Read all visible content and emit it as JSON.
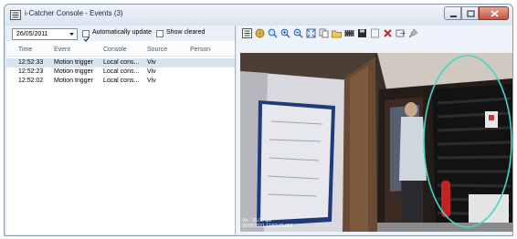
{
  "window": {
    "title": "i-Catcher Console - Events (3)"
  },
  "events_panel": {
    "date_value": "26/05/2011",
    "auto_update_label": "Automatically update",
    "auto_update_checked": true,
    "show_cleared_label": "Show cleared",
    "show_cleared_checked": false,
    "columns": [
      "Time",
      "Event",
      "Console",
      "Source",
      "Person"
    ],
    "rows": [
      {
        "time": "12:52:33",
        "event": "Motion trigger",
        "console": "Local cons...",
        "source": "Viv",
        "person": "",
        "selected": true
      },
      {
        "time": "12:52:23",
        "event": "Motion trigger",
        "console": "Local cons...",
        "source": "Viv",
        "person": "",
        "selected": false
      },
      {
        "time": "12:52:02",
        "event": "Motion trigger",
        "console": "Local cons...",
        "source": "Viv",
        "person": "",
        "selected": false
      }
    ]
  },
  "viewer": {
    "toolbar_icons": [
      "list-icon",
      "globe-icon",
      "zoom-icon",
      "zoom-in-icon",
      "zoom-out-icon",
      "fit-icon",
      "copy-icon",
      "folder-icon",
      "film-icon",
      "save-icon",
      "blank-icon",
      "delete-icon",
      "export-icon",
      "pin-icon"
    ],
    "caption_line1": "Viv - 25.00 fps",
    "caption_line2": "26/05/2011 12:52:33 353"
  },
  "colors": {
    "selection": "#d8e4f2",
    "detection_ellipse": "#40d8c8",
    "delete_icon": "#d42020"
  }
}
